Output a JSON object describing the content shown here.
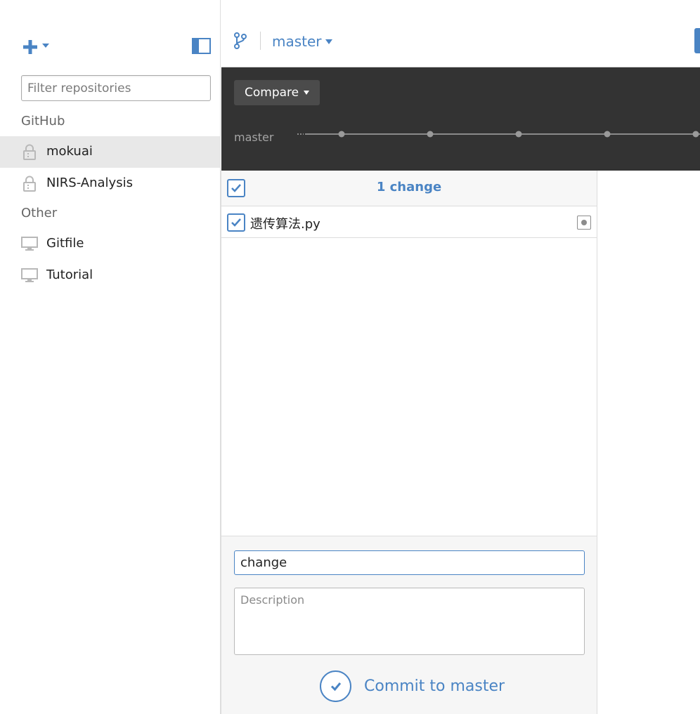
{
  "sidebar": {
    "filter_placeholder": "Filter repositories",
    "sections": [
      {
        "title": "GitHub",
        "repos": [
          {
            "name": "mokuai",
            "icon": "lock-icon",
            "selected": true
          },
          {
            "name": "NIRS-Analysis",
            "icon": "lock-icon",
            "selected": false
          }
        ]
      },
      {
        "title": "Other",
        "repos": [
          {
            "name": "Gitfile",
            "icon": "monitor-icon",
            "selected": false
          },
          {
            "name": "Tutorial",
            "icon": "monitor-icon",
            "selected": false
          }
        ]
      }
    ]
  },
  "header": {
    "branch": "master"
  },
  "timeline": {
    "compare_label": "Compare",
    "branch_label": "master"
  },
  "changes": {
    "count_label": "1 change",
    "files": [
      {
        "name": "遗传算法.py",
        "status": "modified"
      }
    ]
  },
  "commit": {
    "summary_value": "change",
    "description_placeholder": "Description",
    "button_label": "Commit to master"
  },
  "colors": {
    "accent": "#4a84c4",
    "timeline_bg": "#333333",
    "selected_bg": "#e8e8e8"
  }
}
